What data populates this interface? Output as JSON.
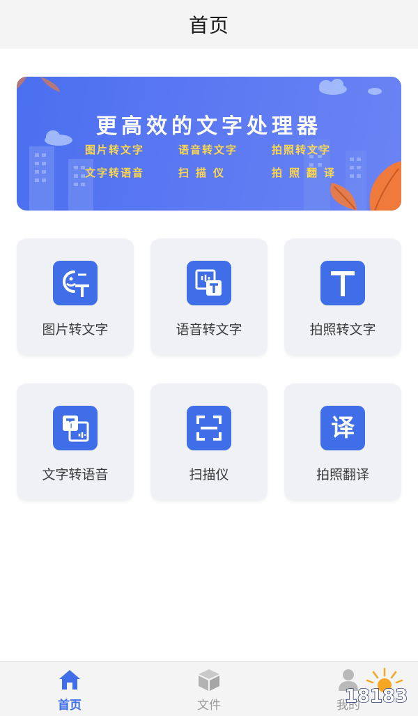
{
  "header": {
    "title": "首页"
  },
  "banner": {
    "headline": "更高效的文字处理器",
    "items": [
      "图片转文字",
      "语音转文字",
      "拍照转文字",
      "文字转语音",
      "扫描仪",
      "拍照翻译"
    ]
  },
  "features": [
    {
      "label": "图片转文字",
      "icon": "image-to-text-icon"
    },
    {
      "label": "语音转文字",
      "icon": "voice-to-text-icon"
    },
    {
      "label": "拍照转文字",
      "icon": "letter-t-icon"
    },
    {
      "label": "文字转语音",
      "icon": "text-to-speech-icon"
    },
    {
      "label": "扫描仪",
      "icon": "scan-frame-icon"
    },
    {
      "label": "拍照翻译",
      "icon": "translate-icon",
      "glyph": "译"
    }
  ],
  "tabbar": {
    "items": [
      {
        "label": "首页",
        "icon": "home-icon",
        "active": true
      },
      {
        "label": "文件",
        "icon": "box-icon",
        "active": false
      },
      {
        "label": "我的",
        "icon": "person-icon",
        "active": false
      }
    ]
  },
  "watermark": {
    "text": "18183"
  },
  "colors": {
    "accent": "#3f6ee8",
    "banner_text": "#ffd84a",
    "tile_bg": "#f0f1f4"
  }
}
